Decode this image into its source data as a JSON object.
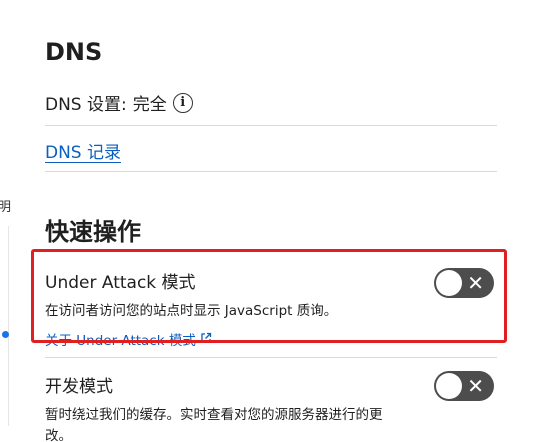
{
  "sidebar_fragment": {
    "text": "明"
  },
  "dns": {
    "title": "DNS",
    "setting_label": "DNS 设置:",
    "setting_value": "完全",
    "records_link": "DNS 记录"
  },
  "quick_actions": {
    "title": "快速操作",
    "under_attack": {
      "title": "Under Attack 模式",
      "description": "在访问者访问您的站点时显示 JavaScript 质询。",
      "link": "关于 Under Attack 模式",
      "enabled": false
    },
    "dev_mode": {
      "title": "开发模式",
      "description": "暂时绕过我们的缓存。实时查看对您的源服务器进行的更改。",
      "enabled": false
    }
  },
  "colors": {
    "link": "#0b5fbf",
    "highlight": "#e02020",
    "toggle_off": "#4d4d4d"
  }
}
